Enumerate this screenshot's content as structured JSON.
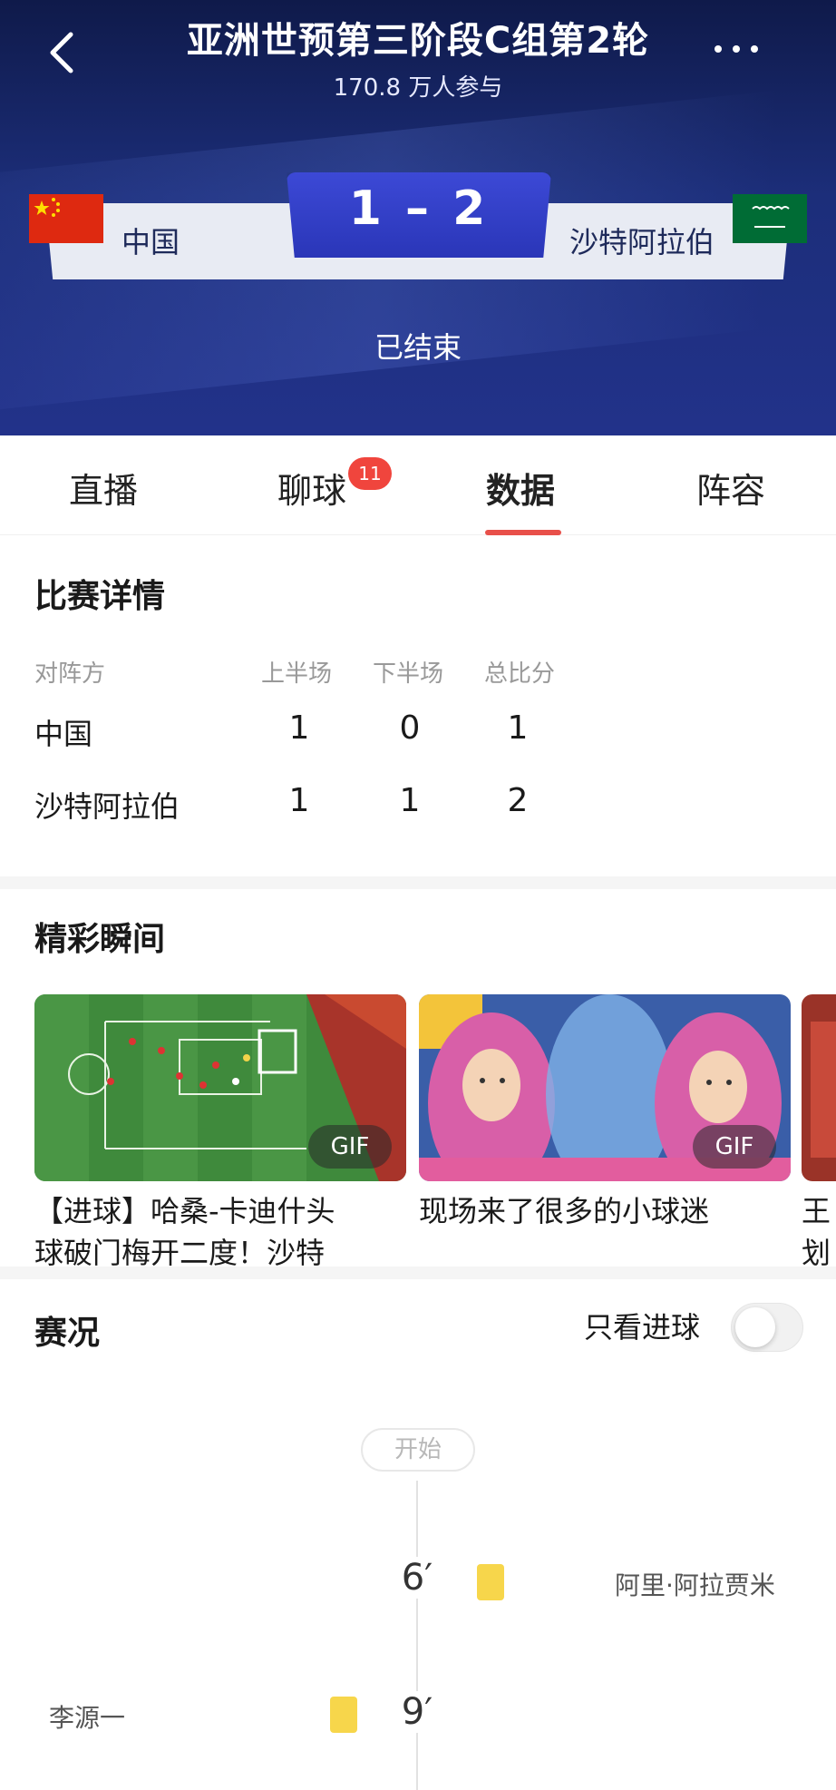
{
  "header": {
    "title": "亚洲世预第三阶段C组第2轮",
    "participants": "170.8 万人参与",
    "home_team": "中国",
    "away_team": "沙特阿拉伯",
    "score": "1 – 2",
    "status": "已结束"
  },
  "tabs": [
    {
      "label": "直播"
    },
    {
      "label": "聊球",
      "badge": "11"
    },
    {
      "label": "数据",
      "active": true
    },
    {
      "label": "阵容"
    }
  ],
  "match_details": {
    "title": "比赛详情",
    "columns": [
      "对阵方",
      "上半场",
      "下半场",
      "总比分"
    ],
    "rows": [
      {
        "team": "中国",
        "first_half": "1",
        "second_half": "0",
        "total": "1"
      },
      {
        "team": "沙特阿拉伯",
        "first_half": "1",
        "second_half": "1",
        "total": "2"
      }
    ]
  },
  "highlights": {
    "title": "精彩瞬间",
    "items": [
      {
        "caption_line1": "【进球】哈桑-卡迪什头",
        "caption_line2": "球破门梅开二度！沙特",
        "tag": "GIF"
      },
      {
        "caption_line1": "现场来了很多的小球迷",
        "tag": "GIF"
      },
      {
        "caption_line1": "王",
        "caption_line2": "划"
      }
    ]
  },
  "live": {
    "title": "赛况",
    "filter_label": "只看进球",
    "start_label": "开始",
    "events": [
      {
        "minute": "6′",
        "side": "away",
        "player": "阿里·阿拉贾米",
        "type": "yellow-card"
      },
      {
        "minute": "9′",
        "side": "home",
        "player": "李源一",
        "type": "yellow-card"
      }
    ]
  },
  "colors": {
    "accent": "#e8504a",
    "header_bg": "#1c2e7a",
    "score_box": "#2a36b8",
    "yellow_card": "#f7d64b"
  }
}
